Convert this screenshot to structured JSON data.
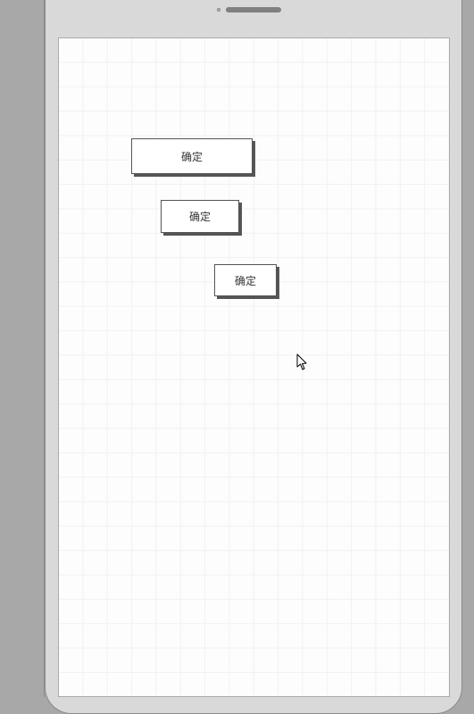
{
  "buttons": {
    "btn1_label": "确定",
    "btn2_label": "确定",
    "btn3_label": "确定"
  }
}
